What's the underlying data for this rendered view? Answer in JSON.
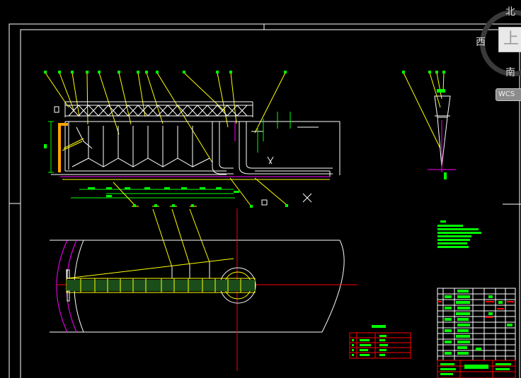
{
  "view_cube": {
    "north": "北",
    "west": "西",
    "south": "南",
    "face": "上",
    "wcs_label": "WCS"
  },
  "colors": {
    "background": "#000000",
    "frame": "#ffffff",
    "linework": "#ffff00",
    "magenta": "#ff00ff",
    "green": "#00ff00",
    "red": "#ff0000",
    "orange": "#ffa500"
  }
}
